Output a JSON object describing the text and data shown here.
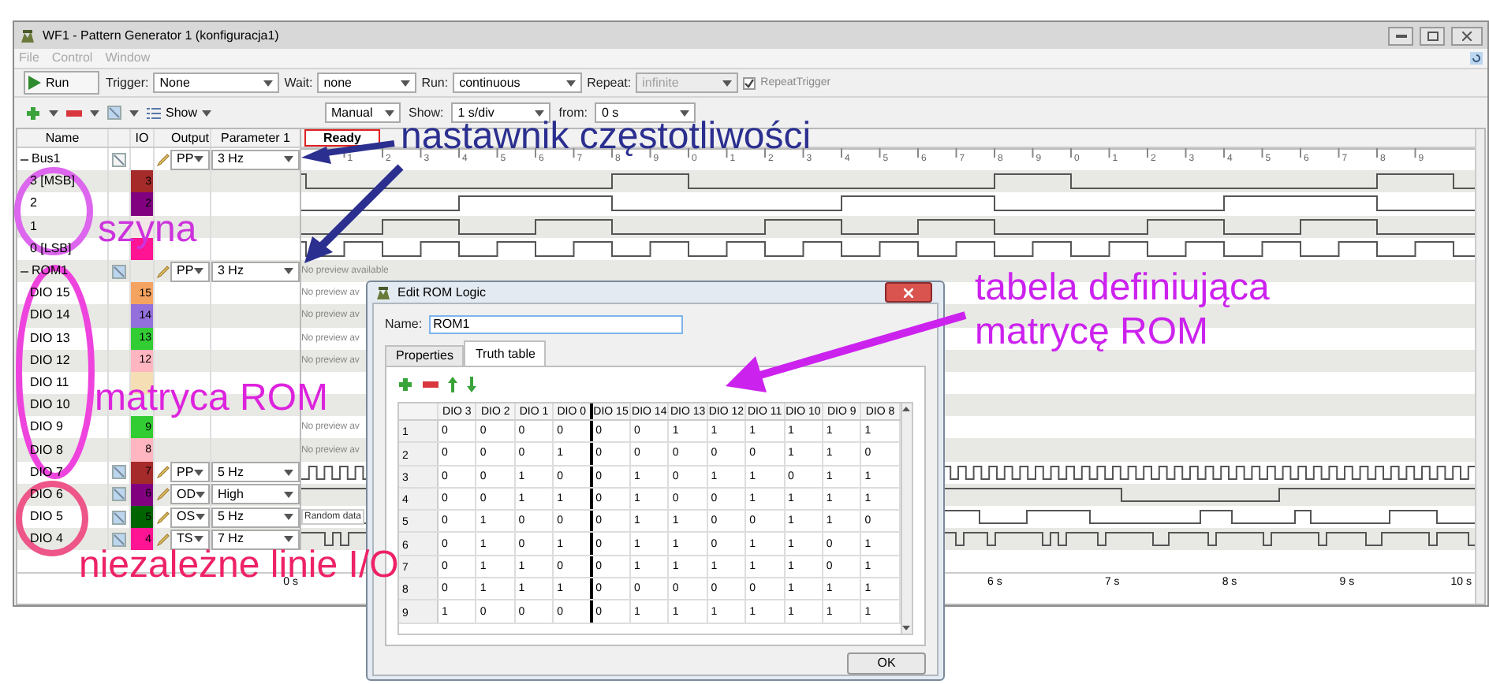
{
  "window": {
    "title": "WF1 - Pattern Generator 1 (konfiguracja1)"
  },
  "menu": [
    {
      "label": "File",
      "disabled": true
    },
    {
      "label": "Control",
      "disabled": true
    },
    {
      "label": "Window",
      "disabled": true
    }
  ],
  "toolbar": {
    "run_button": "Run",
    "trigger": {
      "label": "Trigger:",
      "value": "None"
    },
    "wait": {
      "label": "Wait:",
      "value": "none"
    },
    "run": {
      "label": "Run:",
      "value": "continuous"
    },
    "repeat": {
      "label": "Repeat:",
      "value": "infinite",
      "disabled": true
    },
    "repeat_trigger": {
      "label": "RepeatTrigger",
      "checked": true
    }
  },
  "toolbar2": {
    "show_menu": "Show",
    "mode": "Manual",
    "show": {
      "label": "Show:",
      "value": "1 s/div"
    },
    "from": {
      "label": "from:",
      "value": "0 s"
    }
  },
  "table": {
    "columns": [
      "Name",
      "IO",
      "Output",
      "Parameter 1"
    ],
    "status": "Ready",
    "ruler": [
      "1",
      "2",
      "3",
      "4",
      "5",
      "6",
      "7",
      "8",
      "9",
      "0",
      "1",
      "2",
      "3",
      "4",
      "5",
      "6",
      "7",
      "8",
      "9",
      "0",
      "1",
      "2",
      "3",
      "4",
      "5",
      "6",
      "7",
      "8",
      "9"
    ],
    "rows": [
      {
        "kind": "group",
        "name": "Bus1",
        "expanded": true,
        "output": "PP",
        "parameter": "3 Hz"
      },
      {
        "kind": "bus_line",
        "name": "3 [MSB]",
        "io": "3",
        "color": "#a52a2a"
      },
      {
        "kind": "bus_line",
        "name": "2",
        "io": "2",
        "color": "#800080"
      },
      {
        "kind": "bus_line",
        "name": "1",
        "color": "#f2e6e6"
      },
      {
        "kind": "bus_line",
        "name": "0 [LSB]",
        "color": "#ff1493"
      },
      {
        "kind": "group",
        "name": "ROM1",
        "expanded": true,
        "output": "PP",
        "parameter": "3 Hz",
        "preview": "No preview available"
      },
      {
        "kind": "rom_line",
        "name": "DIO 15",
        "io": "15",
        "color": "#f4a460",
        "preview": "No preview av"
      },
      {
        "kind": "rom_line",
        "name": "DIO 14",
        "io": "14",
        "color": "#9370db",
        "preview": "No preview av"
      },
      {
        "kind": "rom_line",
        "name": "DIO 13",
        "io": "13",
        "color": "#32cd32",
        "preview": "No preview av"
      },
      {
        "kind": "rom_line",
        "name": "DIO 12",
        "io": "12",
        "color": "#ffb6c1",
        "preview": "No preview av"
      },
      {
        "kind": "rom_line",
        "name": "DIO 11",
        "color": "#f5deb3"
      },
      {
        "kind": "rom_line",
        "name": "DIO 10",
        "color": "#e0f5e0"
      },
      {
        "kind": "rom_line",
        "name": "DIO 9",
        "io": "9",
        "color": "#32cd32",
        "preview": "No preview av"
      },
      {
        "kind": "rom_line",
        "name": "DIO 8",
        "io": "8",
        "color": "#ffb6c1",
        "preview": "No preview av"
      },
      {
        "kind": "clock",
        "name": "DIO 7",
        "io": "7",
        "color": "#a52a2a",
        "output": "PP",
        "parameter": "5 Hz"
      },
      {
        "kind": "steps",
        "name": "DIO 6",
        "io": "6",
        "color": "#800080",
        "output": "OD",
        "parameter": "High"
      },
      {
        "kind": "random",
        "name": "DIO 5",
        "io": "5",
        "color": "#006400",
        "output": "OS",
        "parameter": "5 Hz",
        "preview": "Random data"
      },
      {
        "kind": "pulses",
        "name": "DIO 4",
        "io": "4",
        "color": "#ff1493",
        "output": "TS",
        "parameter": "7 Hz"
      }
    ]
  },
  "axis_labels": [
    "0 s",
    "6 s",
    "7 s",
    "8 s",
    "9 s",
    "10 s"
  ],
  "dialog": {
    "title": "Edit ROM Logic",
    "name_label": "Name:",
    "name_value": "ROM1",
    "tabs": [
      {
        "label": "Properties",
        "selected": false
      },
      {
        "label": "Truth table",
        "selected": true
      }
    ],
    "truth_table": {
      "columns": [
        "DIO 3",
        "DIO 2",
        "DIO 1",
        "DIO 0",
        "DIO 15",
        "DIO 14",
        "DIO 13",
        "DIO 12",
        "DIO 11",
        "DIO 10",
        "DIO 9",
        "DIO 8"
      ],
      "rows": [
        {
          "index": "1",
          "cells": [
            "0",
            "0",
            "0",
            "0",
            "0",
            "0",
            "1",
            "1",
            "1",
            "1",
            "1",
            "1"
          ]
        },
        {
          "index": "2",
          "cells": [
            "0",
            "0",
            "0",
            "1",
            "0",
            "0",
            "0",
            "0",
            "0",
            "1",
            "1",
            "0"
          ]
        },
        {
          "index": "3",
          "cells": [
            "0",
            "0",
            "1",
            "0",
            "0",
            "1",
            "0",
            "1",
            "1",
            "0",
            "1",
            "1"
          ]
        },
        {
          "index": "4",
          "cells": [
            "0",
            "0",
            "1",
            "1",
            "0",
            "1",
            "0",
            "0",
            "1",
            "1",
            "1",
            "1"
          ]
        },
        {
          "index": "5",
          "cells": [
            "0",
            "1",
            "0",
            "0",
            "0",
            "1",
            "1",
            "0",
            "0",
            "1",
            "1",
            "0"
          ]
        },
        {
          "index": "6",
          "cells": [
            "0",
            "1",
            "0",
            "1",
            "0",
            "1",
            "1",
            "0",
            "1",
            "1",
            "0",
            "1"
          ]
        },
        {
          "index": "7",
          "cells": [
            "0",
            "1",
            "1",
            "0",
            "0",
            "1",
            "1",
            "1",
            "1",
            "1",
            "0",
            "1"
          ]
        },
        {
          "index": "8",
          "cells": [
            "0",
            "1",
            "1",
            "1",
            "0",
            "0",
            "0",
            "0",
            "0",
            "1",
            "1",
            "1"
          ]
        },
        {
          "index": "9",
          "cells": [
            "1",
            "0",
            "0",
            "0",
            "0",
            "1",
            "1",
            "1",
            "1",
            "1",
            "1",
            "1"
          ]
        }
      ]
    },
    "ok_button": "OK"
  },
  "annotations": [
    {
      "text": "nastawnik częstotliwości",
      "color": "#2b2f8f"
    },
    {
      "text": "szyna",
      "color": "#cc33dd"
    },
    {
      "text": "matryca ROM",
      "color": "#dd22dd"
    },
    {
      "text": "niezależne linie I/O",
      "color": "#ee2266"
    },
    {
      "text": "tabela definiująca matrycę ROM",
      "color": "#cc22ee"
    }
  ]
}
